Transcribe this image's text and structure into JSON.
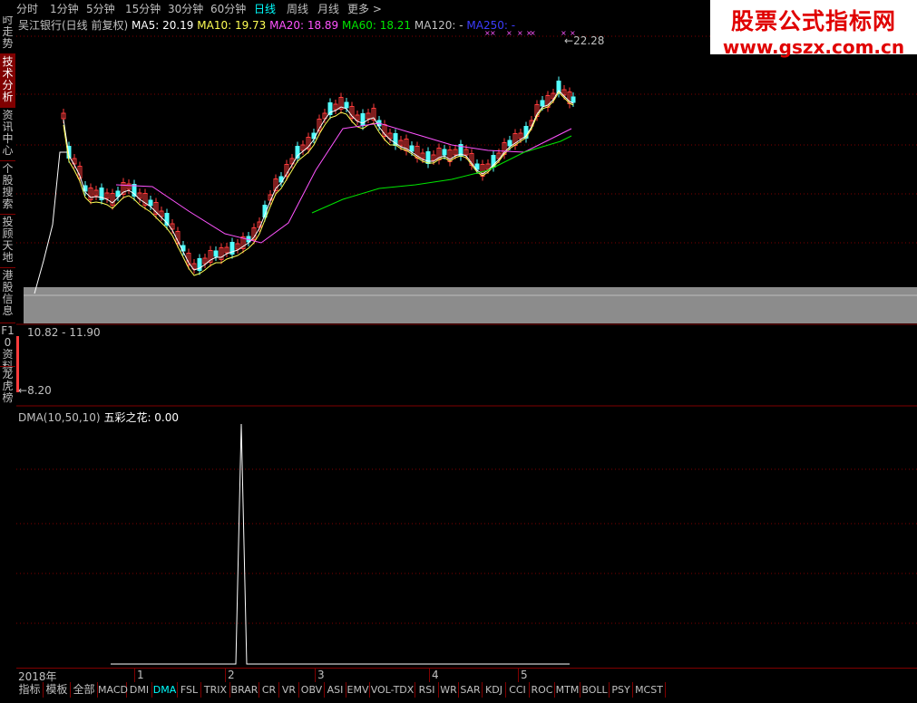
{
  "periods": [
    {
      "label": "分时",
      "active": false
    },
    {
      "label": "1分钟",
      "active": false
    },
    {
      "label": "5分钟",
      "active": false
    },
    {
      "label": "15分钟",
      "active": false
    },
    {
      "label": "30分钟",
      "active": false
    },
    {
      "label": "60分钟",
      "active": false
    },
    {
      "label": "日线",
      "active": true
    },
    {
      "label": "周线",
      "active": false
    },
    {
      "label": "月线",
      "active": false
    },
    {
      "label": "更多 >",
      "active": false
    }
  ],
  "sidebar": [
    {
      "label": "分时走势",
      "active": false
    },
    {
      "label": "技术分析",
      "active": true
    },
    {
      "label": "资讯中心",
      "active": false
    },
    {
      "label": "个股搜索",
      "active": false
    },
    {
      "label": "投顾天地",
      "active": false
    },
    {
      "label": "港股信息",
      "active": false
    },
    {
      "label": "F10资料",
      "active": false
    },
    {
      "label": "龙虎榜",
      "active": false
    }
  ],
  "main_legend": {
    "stock": "吴江银行(日线 前复权)",
    "ma5": "MA5: 20.19",
    "ma10": "MA10: 19.73",
    "ma20": "MA20: 18.89",
    "ma60": "MA60: 18.21",
    "ma120": "MA120: -",
    "ma250": "MA250: -"
  },
  "colors": {
    "up": "#ff3c3c",
    "down": "#54ffff",
    "ma5": "#ffffff",
    "ma10": "#ffff54",
    "ma20": "#ff54ff",
    "ma60": "#00e600",
    "ma250": "#3c3cff",
    "grid": "#800000",
    "band": "#8c8c8c"
  },
  "max_label": "22.28",
  "volume_range": "10.82 - 11.90",
  "low_label": "8.20",
  "sub_legend": {
    "name": "DMA(10,50,10)",
    "formula": "五彩之花: 0.00"
  },
  "time_labels": [
    "2018年",
    "1",
    "2",
    "3",
    "4",
    "5"
  ],
  "bottom_tabs": [
    {
      "label": "指标",
      "cn": true,
      "active": false
    },
    {
      "label": "模板",
      "cn": true,
      "active": false
    },
    {
      "label": "全部",
      "cn": true,
      "active": false
    },
    {
      "label": "MACD",
      "active": false
    },
    {
      "label": "DMI",
      "active": false
    },
    {
      "label": "DMA",
      "active": true
    },
    {
      "label": "FSL",
      "active": false
    },
    {
      "label": "TRIX",
      "active": false
    },
    {
      "label": "BRAR",
      "active": false
    },
    {
      "label": "CR",
      "active": false
    },
    {
      "label": "VR",
      "active": false
    },
    {
      "label": "OBV",
      "active": false
    },
    {
      "label": "ASI",
      "active": false
    },
    {
      "label": "EMV",
      "active": false
    },
    {
      "label": "VOL-TDX",
      "active": false
    },
    {
      "label": "RSI",
      "active": false
    },
    {
      "label": "WR",
      "active": false
    },
    {
      "label": "SAR",
      "active": false
    },
    {
      "label": "KDJ",
      "active": false
    },
    {
      "label": "CCI",
      "active": false
    },
    {
      "label": "ROC",
      "active": false
    },
    {
      "label": "MTM",
      "active": false
    },
    {
      "label": "BOLL",
      "active": false
    },
    {
      "label": "PSY",
      "active": false
    },
    {
      "label": "MCST",
      "active": false
    }
  ],
  "watermark": {
    "title": "股票公式指标网",
    "url": "www.gszx.com.cn"
  }
}
